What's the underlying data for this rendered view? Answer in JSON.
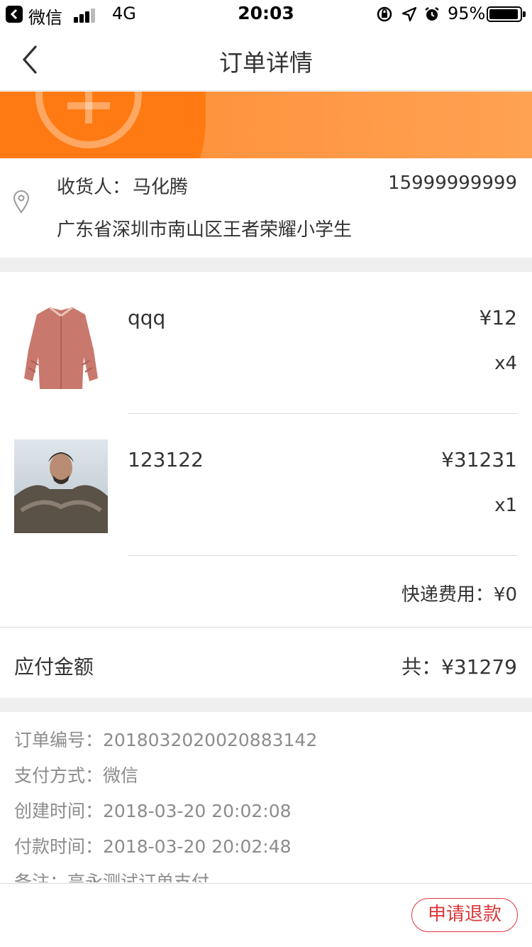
{
  "status_bar": {
    "back_app": "微信",
    "network": "4G",
    "time": "20:03",
    "battery": "95%"
  },
  "nav": {
    "title": "订单详情"
  },
  "address": {
    "label": "收货人：",
    "name": "马化腾",
    "phone": "15999999999",
    "detail": "广东省深圳市南山区王者荣耀小学生"
  },
  "items": [
    {
      "name": "qqq",
      "price": "¥12",
      "qty": "x4"
    },
    {
      "name": "123122",
      "price": "¥31231",
      "qty": "x1"
    }
  ],
  "shipping": "快递费用：¥0",
  "total": {
    "label": "应付金额",
    "value": "共：¥31279"
  },
  "order_info": [
    {
      "key": "订单编号：",
      "value": "2018032020020883142"
    },
    {
      "key": "支付方式：",
      "value": "微信"
    },
    {
      "key": "创建时间：",
      "value": "2018-03-20 20:02:08"
    },
    {
      "key": "付款时间：",
      "value": "2018-03-20 20:02:48"
    },
    {
      "key": "备注：",
      "value": "高永测试订单支付"
    }
  ],
  "actions": {
    "refund_label": "申请退款"
  },
  "colors": {
    "accent": "#ff7a12",
    "danger": "#e0363a"
  }
}
